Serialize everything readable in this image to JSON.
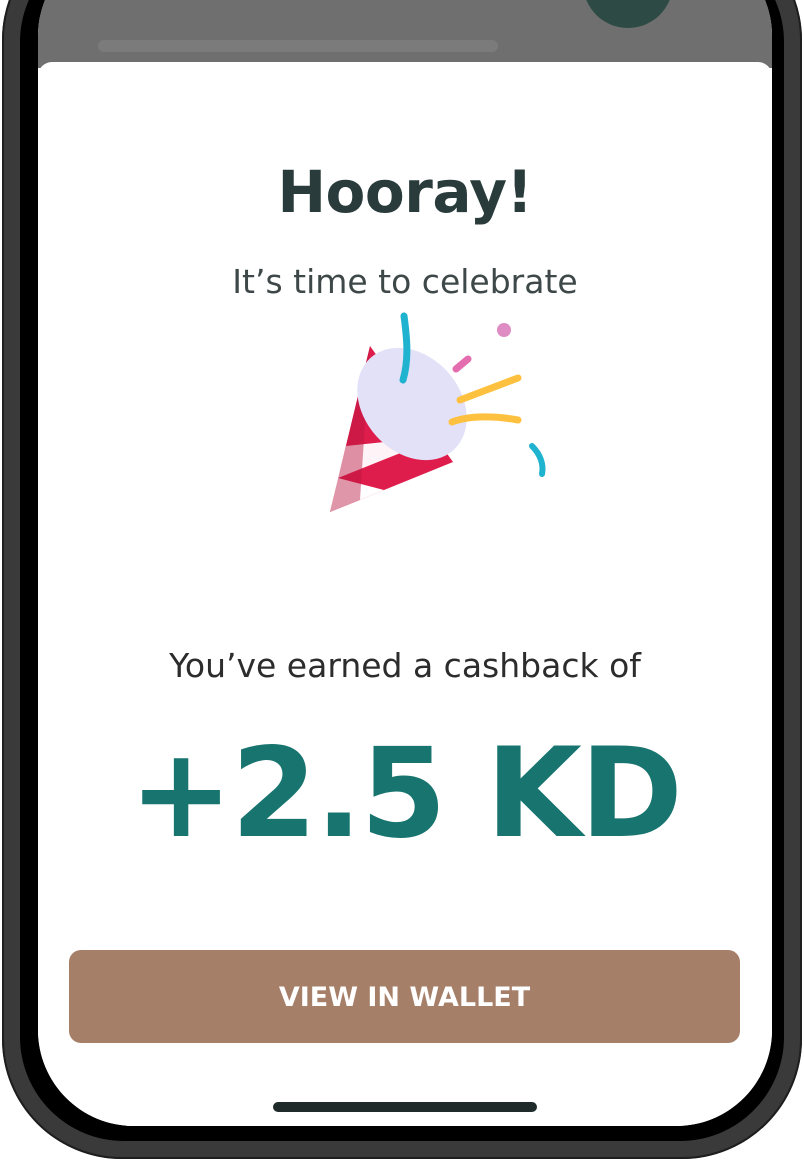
{
  "dialog": {
    "title": "Hooray!",
    "subtitle": "It’s time to celebrate",
    "illustration_icon": "party-popper-icon",
    "earned_text": "You’ve earned a cashback of",
    "cashback_amount": "+2.5 KD",
    "view_wallet_label": "VIEW IN WALLET"
  },
  "colors": {
    "title": "#2a3b3c",
    "amount": "#17746f",
    "button": "#a67f69",
    "button_text": "#ffffff"
  }
}
